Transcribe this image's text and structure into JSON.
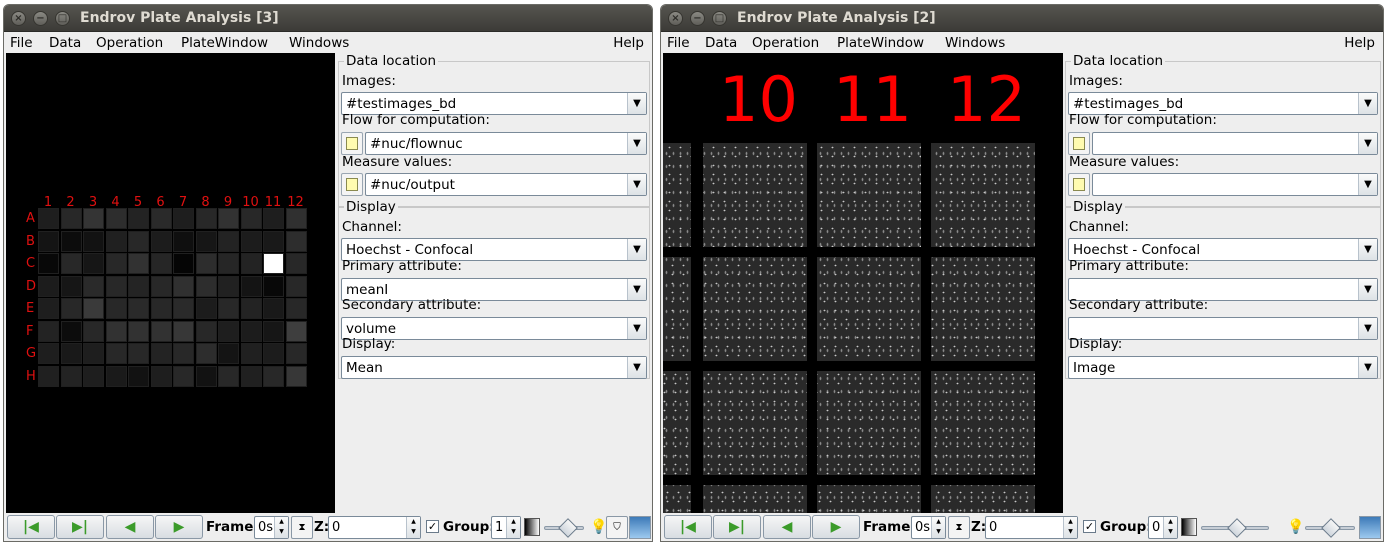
{
  "windows": [
    {
      "title": "Endrov Plate Analysis [3]",
      "menu": [
        "File",
        "Data",
        "Operation",
        "PlateWindow",
        "Windows"
      ],
      "help": "Help",
      "columns": [
        "1",
        "2",
        "3",
        "4",
        "5",
        "6",
        "7",
        "8",
        "9",
        "10",
        "11",
        "12"
      ],
      "rows": [
        "A",
        "B",
        "C",
        "D",
        "E",
        "F",
        "G",
        "H"
      ],
      "heatmap": [
        [
          30,
          40,
          52,
          45,
          35,
          42,
          30,
          40,
          50,
          40,
          30,
          48
        ],
        [
          20,
          12,
          18,
          32,
          40,
          28,
          15,
          22,
          35,
          28,
          25,
          45
        ],
        [
          8,
          40,
          22,
          40,
          50,
          38,
          5,
          45,
          38,
          35,
          255,
          40
        ],
        [
          28,
          22,
          42,
          40,
          36,
          40,
          48,
          45,
          33,
          20,
          8,
          40
        ],
        [
          30,
          40,
          58,
          40,
          42,
          40,
          42,
          28,
          40,
          35,
          25,
          40
        ],
        [
          35,
          12,
          40,
          50,
          50,
          50,
          55,
          40,
          30,
          28,
          22,
          62
        ],
        [
          30,
          25,
          30,
          40,
          40,
          35,
          40,
          45,
          20,
          32,
          28,
          40
        ],
        [
          32,
          35,
          30,
          26,
          18,
          30,
          40,
          18,
          40,
          32,
          40,
          55
        ]
      ],
      "data_location_title": "Data location",
      "images_label": "Images:",
      "images_value": "#testimages_bd",
      "flow_label": "Flow for computation:",
      "flow_value": "#nuc/flownuc",
      "measure_label": "Measure values:",
      "measure_value": "#nuc/output",
      "display_title": "Display",
      "channel_label": "Channel:",
      "channel_value": "Hoechst - Confocal",
      "primary_label": "Primary attribute:",
      "primary_value": "meanI",
      "secondary_label": "Secondary attribute:",
      "secondary_value": "volume",
      "display_label": "Display:",
      "display_value": "Mean",
      "frame_label": "Frame:",
      "frame_value": "0s",
      "z_label": "Z:",
      "z_value": "0",
      "group_label": "Group:",
      "group_value": "1"
    },
    {
      "title": "Endrov Plate Analysis [2]",
      "menu": [
        "File",
        "Data",
        "Operation",
        "PlateWindow",
        "Windows"
      ],
      "help": "Help",
      "big_columns": [
        "10",
        "11",
        "12"
      ],
      "data_location_title": "Data location",
      "images_label": "Images:",
      "images_value": "#testimages_bd",
      "flow_label": "Flow for computation:",
      "flow_value": "",
      "measure_label": "Measure values:",
      "measure_value": "",
      "display_title": "Display",
      "channel_label": "Channel:",
      "channel_value": "Hoechst - Confocal",
      "primary_label": "Primary attribute:",
      "primary_value": "",
      "secondary_label": "Secondary attribute:",
      "secondary_value": "",
      "display_label": "Display:",
      "display_value": "Image",
      "frame_label": "Frame:",
      "frame_value": "0s",
      "z_label": "Z:",
      "z_value": "0",
      "group_label": "Group:",
      "group_value": "0"
    }
  ]
}
